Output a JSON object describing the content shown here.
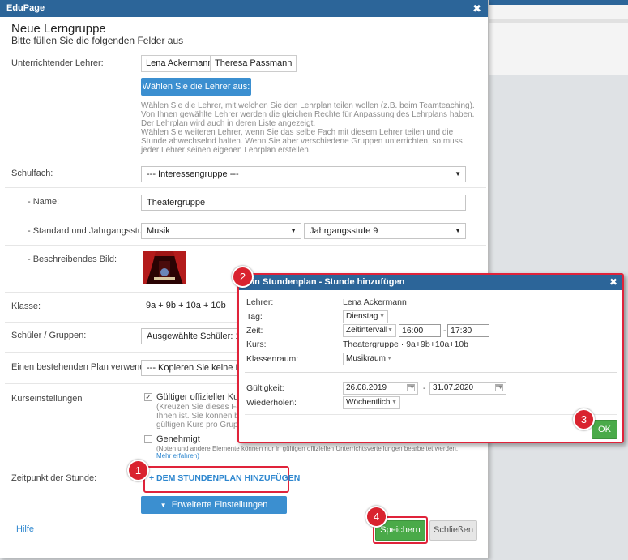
{
  "window": {
    "title": "EduPage"
  },
  "header": {
    "title": "Neue Lerngruppe",
    "subtitle": "Bitte füllen Sie die folgenden Felder aus"
  },
  "teachers": {
    "label": "Unterrichtender Lehrer:",
    "chips": [
      "Lena Ackermann",
      "Theresa Passmann"
    ],
    "choose_button": "Wählen Sie die Lehrer aus:",
    "help_lines": [
      "Wählen Sie die Lehrer, mit welchen Sie den Lehrplan teilen wollen (z.B. beim Teamteaching).",
      "Von Ihnen gewählte Lehrer werden die gleichen Rechte für Anpassung des Lehrplans haben.",
      "Der Lehrplan wird auch in deren Liste angezeigt.",
      "Wählen Sie weiteren Lehrer, wenn Sie das selbe Fach mit diesem Lehrer teilen und die",
      "Stunde abwechselnd halten. Wenn Sie aber verschiedene Gruppen unterrichten, so muss",
      "jeder Lehrer seinen eigenen Lehrplan erstellen."
    ]
  },
  "subject": {
    "label": "Schulfach:",
    "value": "--- Interessengruppe ---"
  },
  "name": {
    "label": "- Name:",
    "value": "Theatergruppe"
  },
  "standard": {
    "label": "- Standard und Jahrgangsstufe:",
    "subject_value": "Musik",
    "grade_value": "Jahrgangsstufe 9"
  },
  "image": {
    "label": "- Beschreibendes Bild:"
  },
  "class": {
    "label": "Klasse:",
    "value": "9a + 9b + 10a + 10b"
  },
  "students": {
    "label": "Schüler / Gruppen:",
    "value": "Ausgewählte Schüler: 18"
  },
  "existing_plan": {
    "label": "Einen bestehenden Plan verwenden:",
    "value": "--- Kopieren Sie keine Dat"
  },
  "course_settings": {
    "label": "Kurseinstellungen",
    "official_label": "Gültiger offizieller Kurs",
    "official_help": [
      "(Kreuzen Sie dieses Fe",
      "Ihnen ist. Sie können b",
      "gültigen Kurs pro Grup"
    ],
    "approved_label": "Genehmigt",
    "approved_help": "(Noten und andere Elemente können nur in gültigen offiziellen Unterrichtsverteilungen bearbeitet werden.",
    "more_link": "Mehr erfahren)"
  },
  "lesson_time": {
    "label": "Zeitpunkt der Stunde:",
    "add_button": "+ DEM STUNDENPLAN HINZUFÜGEN"
  },
  "advanced_button": "Erweiterte Einstellungen anzeigen",
  "help_link": "Hilfe",
  "save_button": "Speichern",
  "close_button": "Schließen",
  "badges": {
    "b1": "1",
    "b2": "2",
    "b3": "3",
    "b4": "4"
  },
  "sub_dialog": {
    "title": "ein Stundenplan - Stunde hinzufügen",
    "teacher_label": "Lehrer:",
    "teacher_value": "Lena Ackermann",
    "day_label": "Tag:",
    "day_value": "Dienstag",
    "time_label": "Zeit:",
    "time_mode": "Zeitintervall",
    "time_from": "16:00",
    "time_dash": "-",
    "time_to": "17:30",
    "course_label": "Kurs:",
    "course_value": "Theatergruppe · 9a+9b+10a+10b",
    "room_label": "Klassenraum:",
    "room_value": "Musikraum",
    "validity_label": "Gültigkeit:",
    "valid_from": "26.08.2019",
    "valid_dash": "-",
    "valid_to": "31.07.2020",
    "repeat_label": "Wiederholen:",
    "repeat_value": "Wöchentlich",
    "ok_button": "OK"
  }
}
